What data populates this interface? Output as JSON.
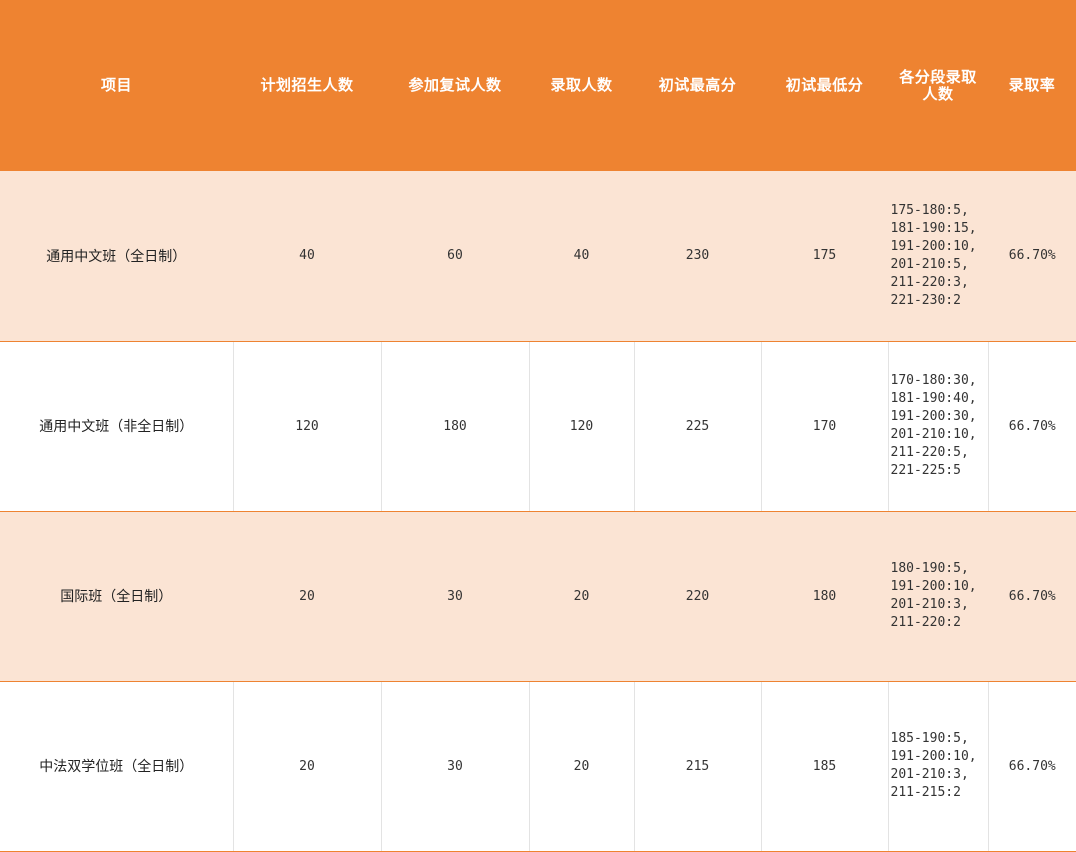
{
  "header": {
    "item": "项目",
    "planned": "计划招生人数",
    "retest": "参加复试人数",
    "admitted": "录取人数",
    "max_score": "初试最高分",
    "min_score": "初试最低分",
    "bands": "各分段录取人数",
    "rate": "录取率"
  },
  "rows": [
    {
      "item": "通用中文班（全日制）",
      "planned": "40",
      "retest": "60",
      "admitted": "40",
      "max_score": "230",
      "min_score": "175",
      "bands": [
        "175-180:5,",
        "181-190:15,",
        "191-200:10,",
        "201-210:5,",
        "211-220:3,",
        "221-230:2"
      ],
      "rate": "66.70%"
    },
    {
      "item": "通用中文班（非全日制）",
      "planned": "120",
      "retest": "180",
      "admitted": "120",
      "max_score": "225",
      "min_score": "170",
      "bands": [
        "170-180:30,",
        "181-190:40,",
        "191-200:30,",
        "201-210:10,",
        "211-220:5,",
        "221-225:5"
      ],
      "rate": "66.70%"
    },
    {
      "item": "国际班（全日制）",
      "planned": "20",
      "retest": "30",
      "admitted": "20",
      "max_score": "220",
      "min_score": "180",
      "bands": [
        "180-190:5,",
        "191-200:10,",
        "201-210:3,",
        "211-220:2"
      ],
      "rate": "66.70%"
    },
    {
      "item": "中法双学位班（全日制）",
      "planned": "20",
      "retest": "30",
      "admitted": "20",
      "max_score": "215",
      "min_score": "185",
      "bands": [
        "185-190:5,",
        "191-200:10,",
        "201-210:3,",
        "211-215:2"
      ],
      "rate": "66.70%"
    }
  ]
}
